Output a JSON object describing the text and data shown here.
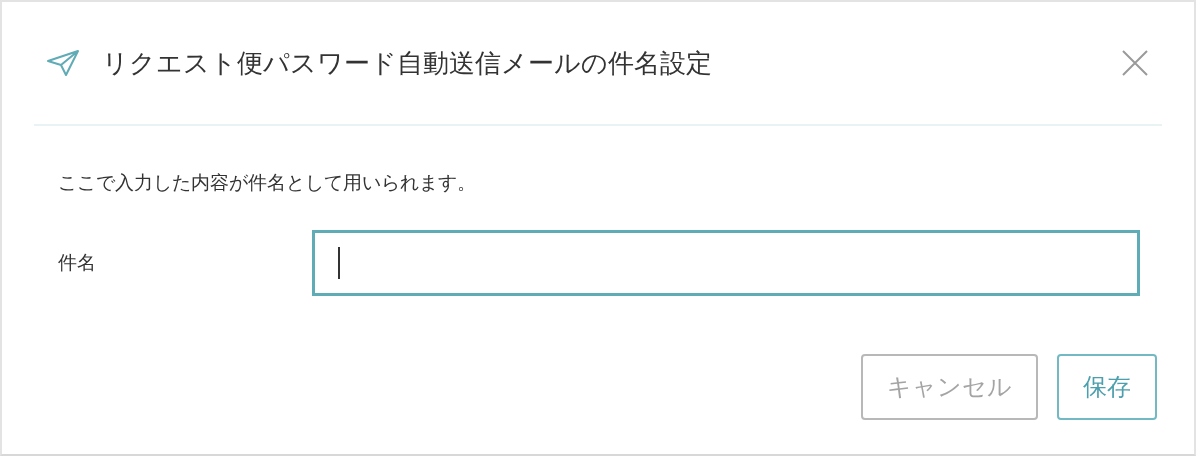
{
  "dialog": {
    "title": "リクエスト便パスワード自動送信メールの件名設定",
    "description": "ここで入力した内容が件名として用いられます。",
    "field": {
      "label": "件名",
      "focused": true
    },
    "buttons": [
      {
        "label": "キャンセル",
        "kind": "secondary"
      },
      {
        "label": "保存",
        "kind": "primary"
      }
    ]
  }
}
